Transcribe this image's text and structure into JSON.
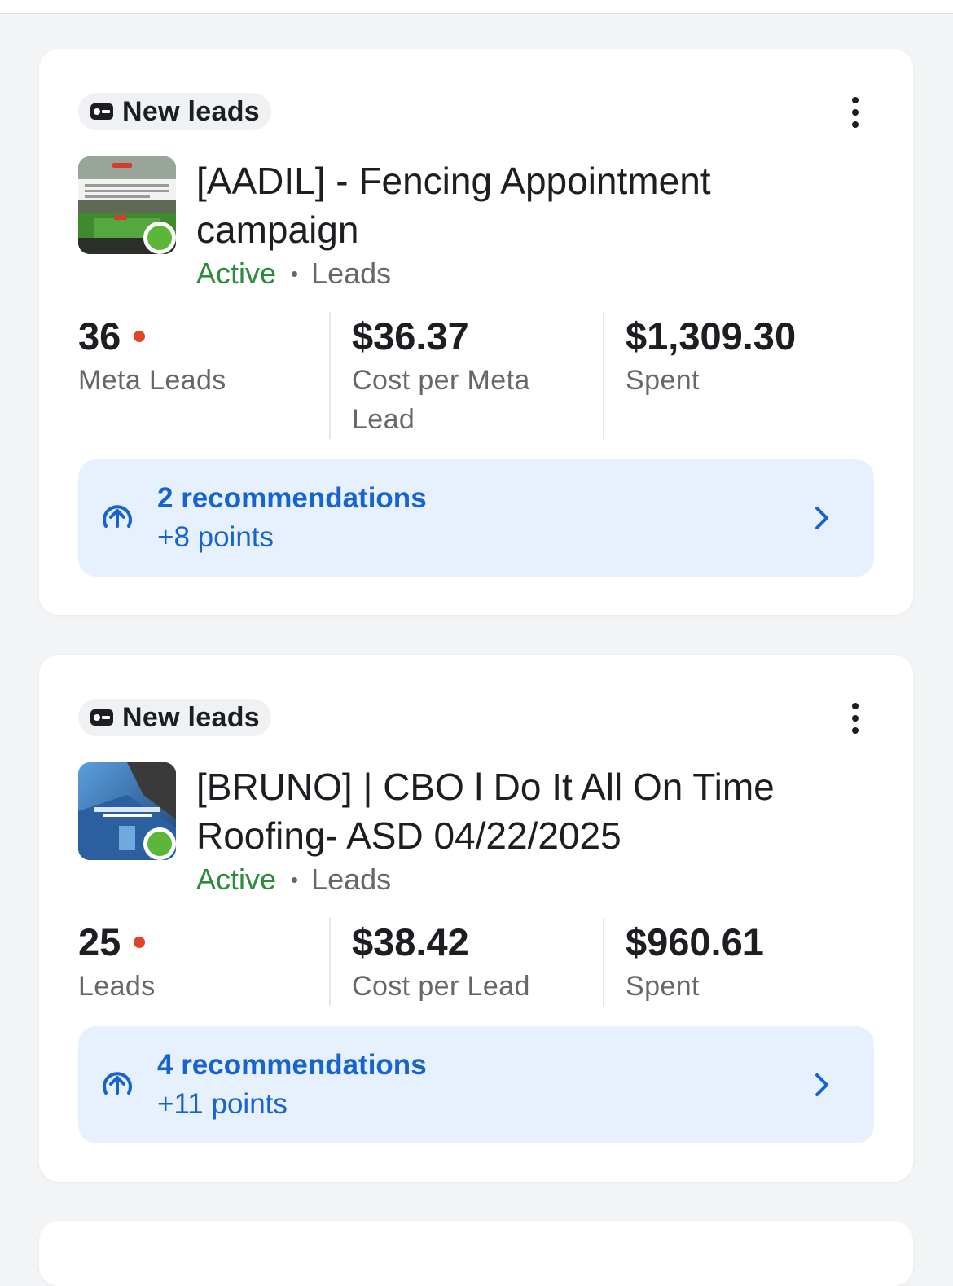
{
  "cards": [
    {
      "badge_label": "New leads",
      "title_line1": "[AADIL] - Fencing Appointment",
      "title_line2": "campaign",
      "status": "Active",
      "objective": "Leads",
      "metrics": [
        {
          "value": "36",
          "label_line1": "Meta Leads",
          "label_line2": ""
        },
        {
          "value": "$36.37",
          "label_line1": "Cost per Meta",
          "label_line2": "Lead"
        },
        {
          "value": "$1,309.30",
          "label_line1": "Spent",
          "label_line2": ""
        }
      ],
      "recommendations": {
        "count_text": "2 recommendations",
        "points_text": "+8 points"
      }
    },
    {
      "badge_label": "New leads",
      "title_line1": "[BRUNO] | CBO l Do It All On Time",
      "title_line2": "Roofing- ASD 04/22/2025",
      "status": "Active",
      "objective": "Leads",
      "metrics": [
        {
          "value": "25",
          "label_line1": "Leads",
          "label_line2": ""
        },
        {
          "value": "$38.42",
          "label_line1": "Cost per Lead",
          "label_line2": ""
        },
        {
          "value": "$960.61",
          "label_line1": "Spent",
          "label_line2": ""
        }
      ],
      "recommendations": {
        "count_text": "4 recommendations",
        "points_text": "+11 points"
      }
    }
  ],
  "icons": {
    "badge": "lead-form-icon",
    "more": "more-vertical-icon",
    "recommendation": "arrow-up-circle-icon",
    "chevron": "chevron-right-icon"
  },
  "colors": {
    "active_status": "#2e8b3a",
    "status_dot": "#5bb73a",
    "alert_dot": "#e0452a",
    "recommendation_bg": "#e7f1fd",
    "recommendation_text": "#1763cf"
  }
}
